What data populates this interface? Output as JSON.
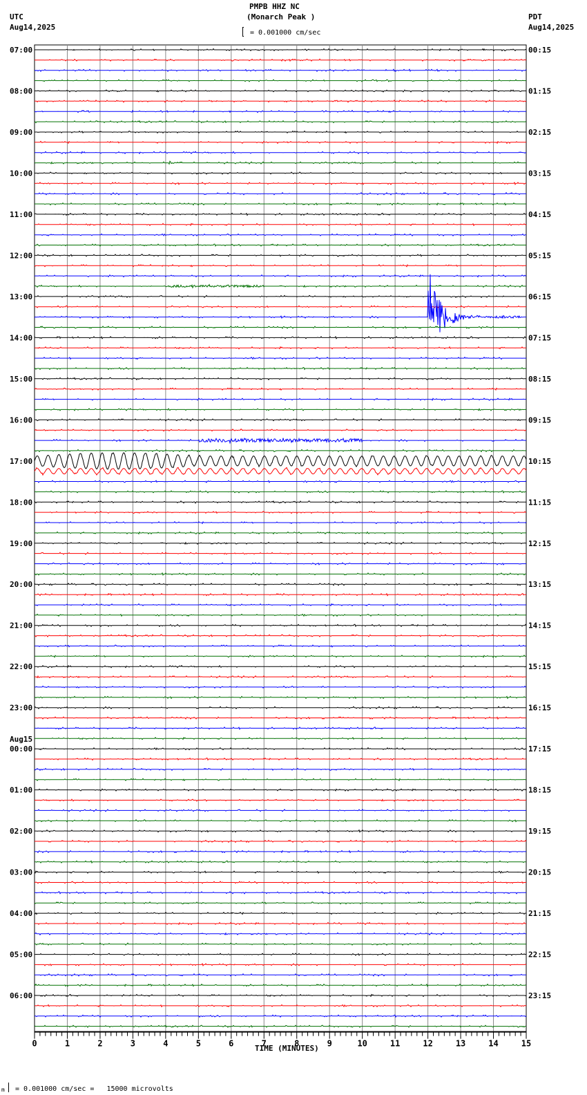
{
  "header": {
    "title": "PMPB HHZ NC",
    "subtitle": "(Monarch Peak )",
    "left_tz": "UTC",
    "left_date": "Aug14,2025",
    "right_tz": "PDT",
    "right_date": "Aug14,2025",
    "scale": "= 0.001000 cm/sec"
  },
  "footer": {
    "scale": "= 0.001000 cm/sec =   15000 microvolts"
  },
  "chart_data": {
    "type": "line",
    "subtype": "helicorder",
    "xlabel": "TIME (MINUTES)",
    "xlim": [
      0,
      15
    ],
    "x_ticks": [
      "0",
      "1",
      "2",
      "3",
      "4",
      "5",
      "6",
      "7",
      "8",
      "9",
      "10",
      "11",
      "12",
      "13",
      "14",
      "15"
    ],
    "trace_colors": [
      "#000000",
      "#ff0000",
      "#0000ff",
      "#007000"
    ],
    "rows_per_hour": 4,
    "left_labels": [
      "07:00",
      "08:00",
      "09:00",
      "10:00",
      "11:00",
      "12:00",
      "13:00",
      "14:00",
      "15:00",
      "16:00",
      "17:00",
      "18:00",
      "19:00",
      "20:00",
      "21:00",
      "22:00",
      "23:00",
      "00:00",
      "01:00",
      "02:00",
      "03:00",
      "04:00",
      "05:00",
      "06:00"
    ],
    "date_change_label": "Aug15",
    "date_change_hour_index": 17,
    "right_labels": [
      "00:15",
      "01:15",
      "02:15",
      "03:15",
      "04:15",
      "05:15",
      "06:15",
      "07:15",
      "08:15",
      "09:15",
      "10:15",
      "11:15",
      "12:15",
      "13:15",
      "14:15",
      "15:15",
      "16:15",
      "17:15",
      "18:15",
      "19:15",
      "20:15",
      "21:15",
      "22:15",
      "23:15"
    ],
    "events": [
      {
        "row": 11,
        "start_min": 4.1,
        "end_min": 4.3,
        "amplitude": 8,
        "kind": "local"
      },
      {
        "row": 23,
        "start_min": 4.0,
        "end_min": 7.0,
        "amplitude": 1.5,
        "kind": "emergent"
      },
      {
        "row": 26,
        "start_min": 12.0,
        "end_min": 14.9,
        "amplitude": 80,
        "kind": "earthquake"
      },
      {
        "row": 38,
        "start_min": 5.0,
        "end_min": 10.0,
        "amplitude": 2.5,
        "kind": "emergent"
      },
      {
        "row": 40,
        "start_min": 0.0,
        "end_min": 15.0,
        "amplitude": 12,
        "kind": "teleseism",
        "period_min": 0.33
      },
      {
        "row": 41,
        "start_min": 0.0,
        "end_min": 15.0,
        "amplitude": 4,
        "kind": "teleseism",
        "period_min": 0.33
      },
      {
        "row": 84,
        "start_min": 6.0,
        "end_min": 6.3,
        "amplitude": 3,
        "kind": "local"
      }
    ]
  }
}
